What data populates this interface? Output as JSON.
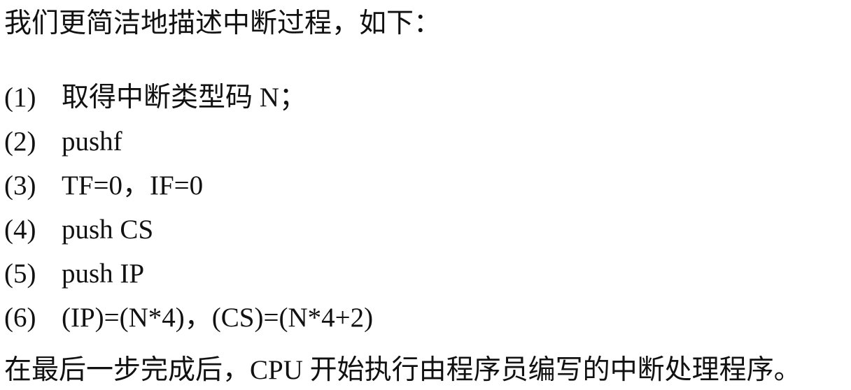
{
  "doc": {
    "intro": "我们更简洁地描述中断过程，如下：",
    "steps": [
      {
        "num": "(1)",
        "text": "取得中断类型码 N；"
      },
      {
        "num": "(2)",
        "text": "pushf"
      },
      {
        "num": "(3)",
        "text": "TF=0，IF=0"
      },
      {
        "num": "(4)",
        "text": "push CS"
      },
      {
        "num": "(5)",
        "text": "push IP"
      },
      {
        "num": "(6)",
        "text": "(IP)=(N*4)，(CS)=(N*4+2)"
      }
    ],
    "outro": "在最后一步完成后，CPU 开始执行由程序员编写的中断处理程序。"
  }
}
